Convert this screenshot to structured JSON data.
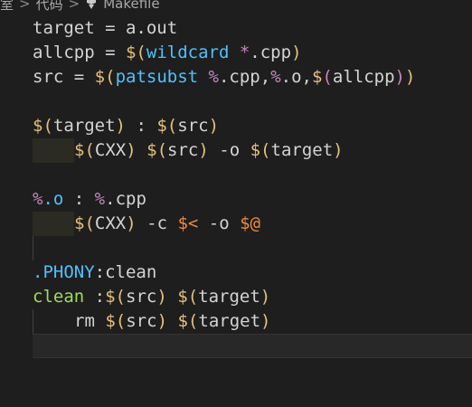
{
  "breadcrumb": {
    "items": [
      "室",
      "代码",
      "Makefile"
    ],
    "separator": ">"
  },
  "code": {
    "line1": {
      "a": "target",
      "b": " = ",
      "c": "a.out"
    },
    "line2": {
      "a": "allcpp",
      "b": " = ",
      "c": "$",
      "d": "(",
      "e": "wildcard",
      "f": " ",
      "g": "*",
      "h": ".cpp",
      "i": ")"
    },
    "line3": {
      "a": "src",
      "b": " = ",
      "c": "$",
      "d": "(",
      "e": "patsubst",
      "f": " ",
      "g": "%",
      "h": ".cpp,",
      "i": "%",
      "j": ".o,",
      "k": "$",
      "l": "(",
      "m": "allcpp",
      "n": ")",
      "o": ")"
    },
    "line5": {
      "a": "$",
      "b": "(",
      "c": "target",
      "d": ")",
      "e": " : ",
      "f": "$",
      "g": "(",
      "h": "src",
      "i": ")"
    },
    "line6": {
      "a": "$",
      "b": "(",
      "c": "CXX",
      "d": ")",
      "e": " ",
      "f": "$",
      "g": "(",
      "h": "src",
      "i": ")",
      "j": " -o ",
      "k": "$",
      "l": "(",
      "m": "target",
      "n": ")"
    },
    "line8": {
      "a": "%",
      "b": ".o",
      "c": " : ",
      "d": "%",
      "e": ".cpp"
    },
    "line9": {
      "a": "$",
      "b": "(",
      "c": "CXX",
      "d": ")",
      "e": " -c ",
      "f": "$<",
      "g": " -o ",
      "h": "$@"
    },
    "line11": {
      "a": ".PHONY",
      "b": ":clean"
    },
    "line12": {
      "a": "clean",
      "b": " :",
      "c": "$",
      "d": "(",
      "e": "src",
      "f": ")",
      "g": " ",
      "h": "$",
      "i": "(",
      "j": "target",
      "k": ")"
    },
    "line13": {
      "a": "rm ",
      "b": "$",
      "c": "(",
      "d": "src",
      "e": ")",
      "f": " ",
      "g": "$",
      "h": "(",
      "i": "target",
      "j": ")"
    }
  },
  "colors": {
    "background": "#1e1e1e",
    "plain": "#d4d4d4",
    "variable_ref": "#e5c07b",
    "function": "#4fc1ff",
    "pattern": "#c586c0",
    "auto_var": "#f0883e",
    "phony": "#4fc1ff",
    "clean_target": "#9cdc5a"
  }
}
